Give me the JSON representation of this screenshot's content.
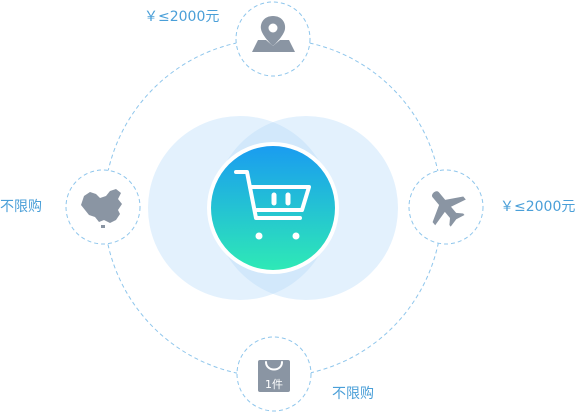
{
  "colors": {
    "accent_text": "#4a9fd8",
    "dashed_line": "#8fc6ec",
    "icon_gray": "#8a95a3",
    "halo": "#e3f1fd",
    "halo_overlap": "#d2e8fb",
    "gradient_top": "#1a9cf0",
    "gradient_bottom": "#2ee9b6",
    "center_icon": "#ffffff"
  },
  "center": {
    "icon": "shopping-cart-icon"
  },
  "nodes": [
    {
      "id": "top",
      "icon": "map-location-icon",
      "label": "￥≤2000元"
    },
    {
      "id": "right",
      "icon": "airplane-icon",
      "label": "￥≤2000元"
    },
    {
      "id": "left",
      "icon": "china-map-icon",
      "label": "不限购"
    },
    {
      "id": "bottom",
      "icon": "shopping-bag-icon",
      "label": "不限购",
      "bag_text": "1件"
    }
  ]
}
